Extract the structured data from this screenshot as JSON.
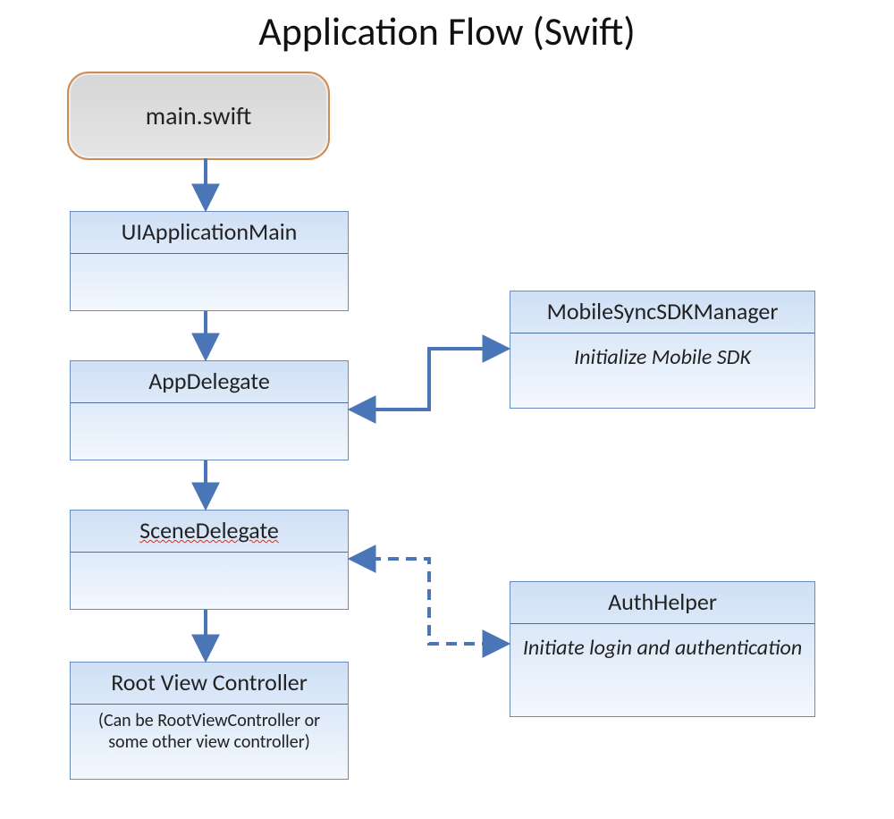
{
  "title": "Application Flow (Swift)",
  "start": {
    "label": "main.swift"
  },
  "left": [
    {
      "header": "UIApplicationMain",
      "body": ""
    },
    {
      "header": "AppDelegate",
      "body": ""
    },
    {
      "header": "SceneDelegate",
      "body": "",
      "wavy": true
    },
    {
      "header": "Root View Controller",
      "body": "(Can be RootViewController or some other view controller)"
    }
  ],
  "right": [
    {
      "header": "MobileSyncSDKManager",
      "body": "Initialize Mobile SDK"
    },
    {
      "header": "AuthHelper",
      "body": "Initiate login and authentication"
    }
  ],
  "colors": {
    "arrow": "#4a75b7"
  }
}
